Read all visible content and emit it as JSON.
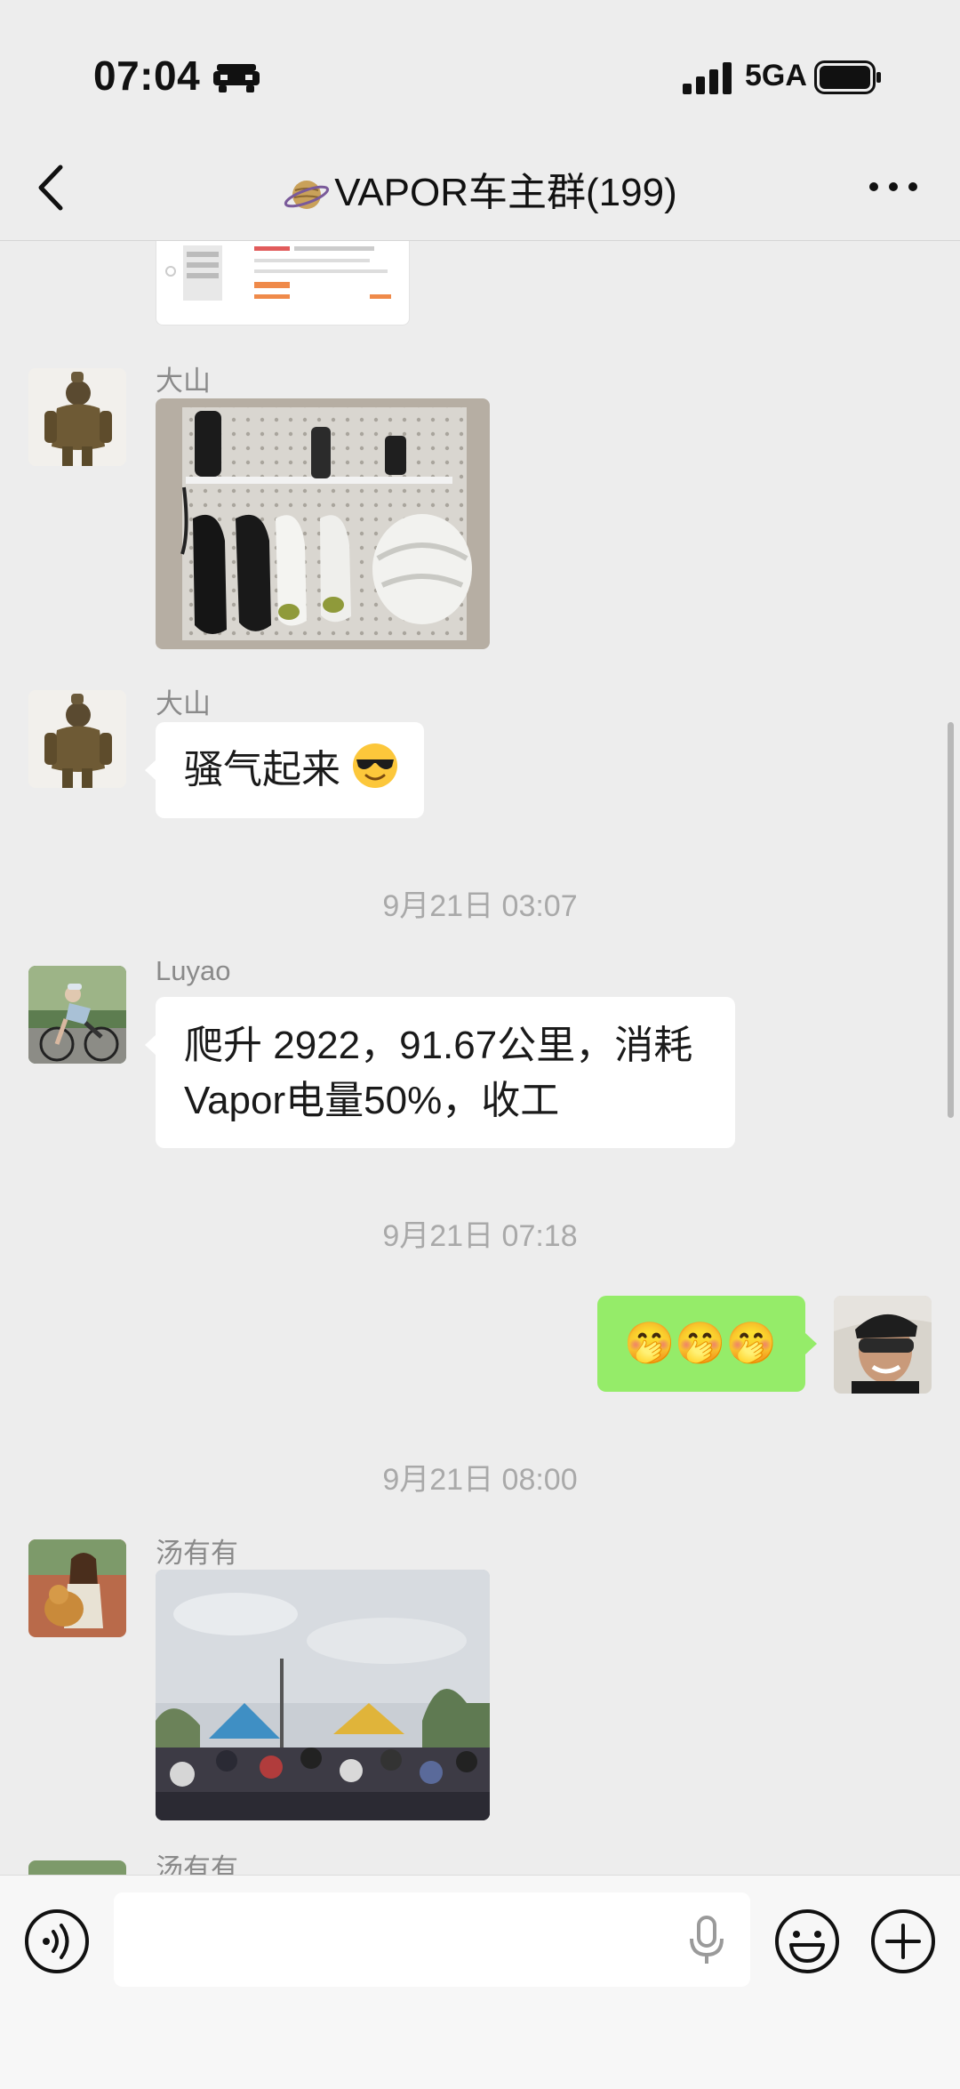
{
  "status_bar": {
    "time": "07:04",
    "network": "5GA"
  },
  "header": {
    "title": "VAPOR车主群(199)"
  },
  "messages": {
    "m1": {
      "sender": "大山"
    },
    "m2": {
      "sender": "大山",
      "text": "骚气起来"
    },
    "t1": {
      "time": "9月21日 03:07"
    },
    "m3": {
      "sender": "Luyao",
      "line1": "爬升 2922，91.67公里，消耗",
      "line2": "Vapor电量50%，收工"
    },
    "t2": {
      "time": "9月21日 07:18"
    },
    "m4": {
      "emoji": "🤭🤭🤭"
    },
    "t3": {
      "time": "9月21日 08:00"
    },
    "m5": {
      "sender": "汤有有"
    },
    "m6": {
      "sender": "汤有有"
    }
  },
  "icons": {
    "back": "chevron-left-icon",
    "more": "more-dots-icon",
    "voice": "voice-icon",
    "mic": "mic-icon",
    "emoji": "emoji-icon",
    "plus": "plus-icon"
  },
  "colors": {
    "self_bubble": "#95ec69",
    "background": "#ededed"
  }
}
